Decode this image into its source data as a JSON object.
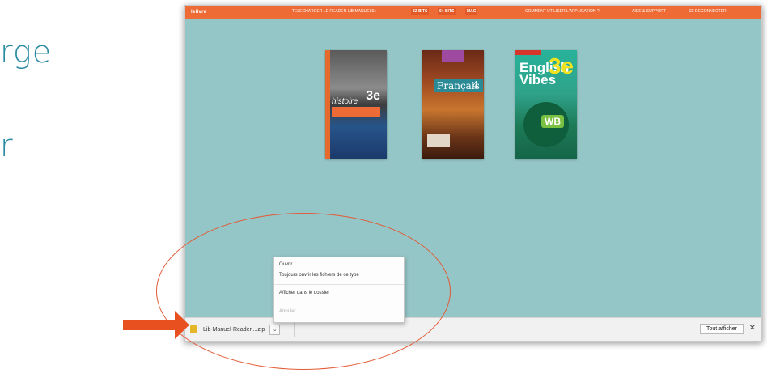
{
  "slide": {
    "partial_text_1": "rge",
    "partial_text_2": "r"
  },
  "app": {
    "brand": "lelivre",
    "nav": {
      "download_reader": "TELECHARGER LE READER LIB MANUELS :",
      "win32": "32 BITS",
      "win64": "64 BITS",
      "mac": "MAC",
      "how_to": "COMMENT UTILISER L'APPLICATION ?",
      "help": "AIDE & SUPPORT",
      "logout": "SE DECONNECTER"
    },
    "colors": {
      "topbar": "#ee6b35",
      "background": "#95c6c7"
    }
  },
  "books": [
    {
      "title": "histoire",
      "level": "3e"
    },
    {
      "title": "Français",
      "level": "4"
    },
    {
      "title": "English Vibes",
      "level": "3e",
      "badge": "WB"
    }
  ],
  "download": {
    "file_name": "Lib-Manuel-Reader....zip",
    "show_all": "Tout afficher",
    "close": "✕",
    "menu": {
      "open": "Ouvrir",
      "always_open": "Toujours ouvrir les fichiers de ce type",
      "show_in_folder": "Afficher dans le dossier",
      "cancel": "Annuler"
    }
  },
  "annotations": {
    "ellipse_color": "#e25a35",
    "arrow_color": "#e8501f",
    "arrow_icon": "right-arrow-icon"
  }
}
